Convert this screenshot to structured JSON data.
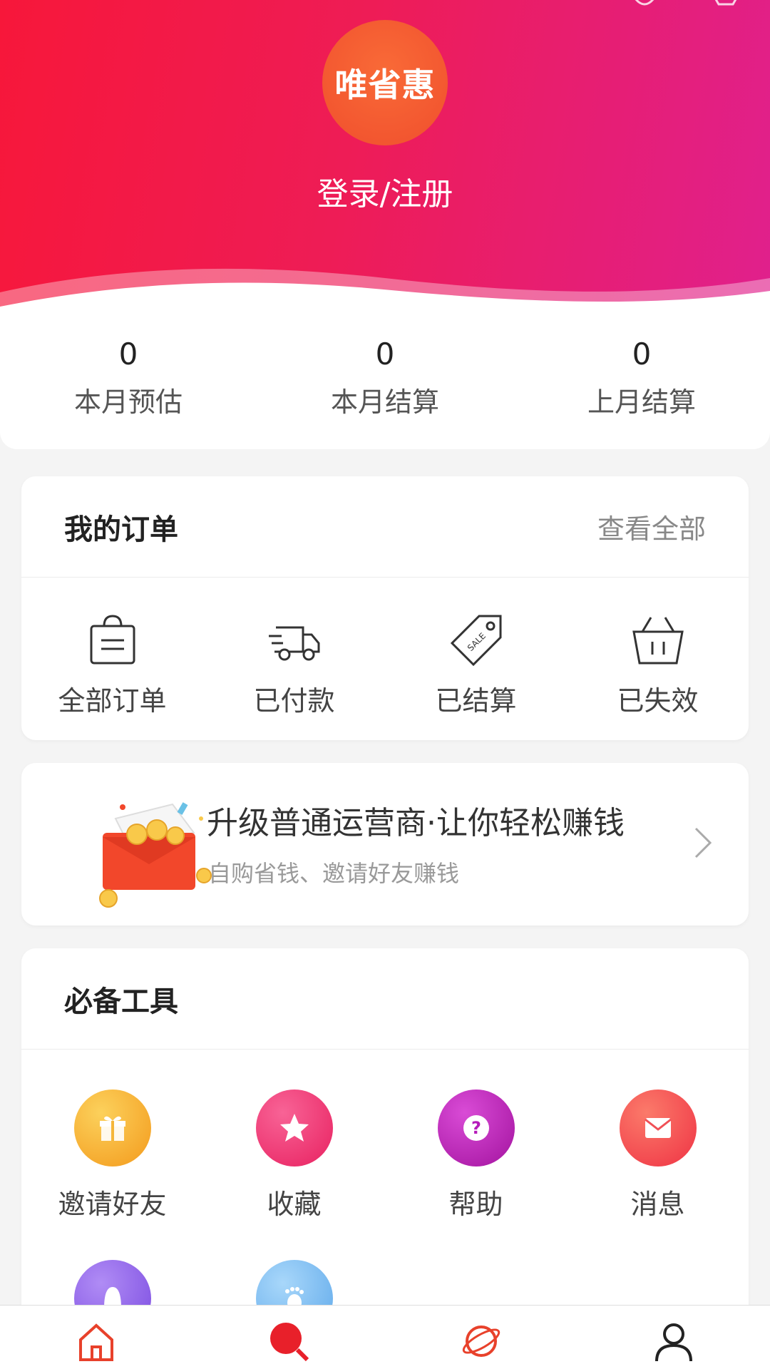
{
  "header": {
    "brand_logo_text": "唯省惠",
    "login_label": "登录/注册",
    "colors": {
      "gradient_start": "#f7173a",
      "gradient_end": "#e0208d"
    }
  },
  "stats": [
    {
      "value": "0",
      "label": "本月预估"
    },
    {
      "value": "0",
      "label": "本月结算"
    },
    {
      "value": "0",
      "label": "上月结算"
    }
  ],
  "orders": {
    "title": "我的订单",
    "view_all": "查看全部",
    "items": [
      {
        "label": "全部订单",
        "icon": "shopping-bag-icon"
      },
      {
        "label": "已付款",
        "icon": "delivery-truck-icon"
      },
      {
        "label": "已结算",
        "icon": "sale-tag-icon"
      },
      {
        "label": "已失效",
        "icon": "basket-icon"
      }
    ]
  },
  "promo": {
    "title": "升级普通运营商·让你轻松赚钱",
    "subtitle": "自购省钱、邀请好友赚钱",
    "icon": "red-envelope-coins-icon"
  },
  "tools": {
    "title": "必备工具",
    "items": [
      {
        "label": "邀请好友",
        "icon": "gift-icon",
        "color": "#f7a624"
      },
      {
        "label": "收藏",
        "icon": "star-icon",
        "color": "#f0306a"
      },
      {
        "label": "帮助",
        "icon": "question-icon",
        "color": "#b51cba"
      },
      {
        "label": "消息",
        "icon": "mail-icon",
        "color": "#f24a4e"
      },
      {
        "label": "",
        "icon": "user-bubble-icon",
        "color": "#8e63e8"
      },
      {
        "label": "",
        "icon": "footprint-icon",
        "color": "#6fb6ef"
      }
    ]
  },
  "tabbar": {
    "items": [
      {
        "icon": "home-icon"
      },
      {
        "icon": "search-icon"
      },
      {
        "icon": "planet-icon"
      },
      {
        "icon": "profile-icon"
      }
    ]
  }
}
